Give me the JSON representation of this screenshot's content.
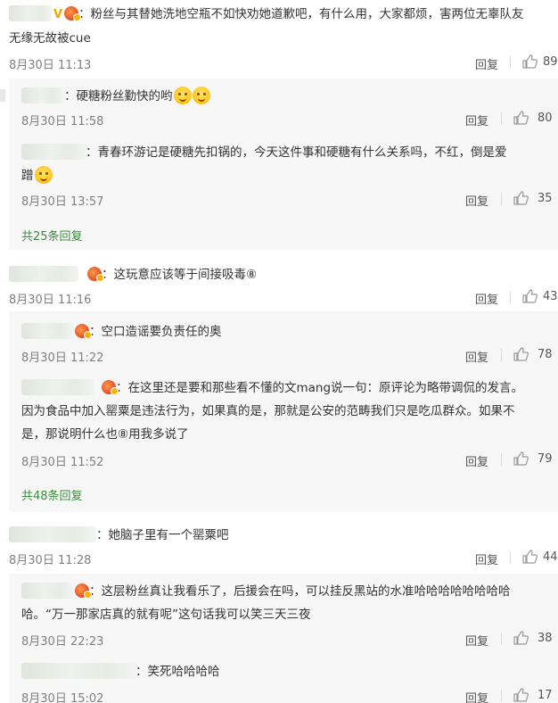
{
  "comments": [
    {
      "text": "：粉丝与其替她洗地空瓶不如快劝她道歉吧，有什么用，大家都烦，害两位无辜队友无缘无故被cue",
      "line1": "：粉丝与其替她洗地空瓶不如快劝她道歉吧，有什么用，大家都烦，害两位无辜队友",
      "line2": "无缘无故被cue",
      "verified_mark": "V",
      "time": "8月30日 11:13",
      "reply": "回复",
      "likes": "89",
      "replies": [
        {
          "text": "：硬糖粉丝勤快的哟",
          "time": "8月30日 11:58",
          "reply": "回复",
          "likes": "80"
        },
        {
          "line1": "：青春环游记是硬糖先扣锅的，今天这件事和硬糖有什么关系吗，不红，倒是爱",
          "line2": "蹭",
          "time": "8月30日 13:57",
          "reply": "回复",
          "likes": "35"
        }
      ],
      "more": "共25条回复"
    },
    {
      "text": "：这玩意应该等于间接吸毒⑧",
      "time": "8月30日 11:16",
      "reply": "回复",
      "likes": "43",
      "replies": [
        {
          "text": "：空口造谣要负责任的奥",
          "time": "8月30日 11:22",
          "reply": "回复",
          "likes": "78"
        },
        {
          "line1": "：在这里还是要和那些看不懂的文mang说一句：原评论为略带调侃的发言。",
          "line2": "因为食品中加入罂粟是违法行为，如果真的是，那就是公安的范畴我们只是吃瓜群众。如果不",
          "line3": "是，那说明什么也⑧用我多说了",
          "time": "8月30日 11:52",
          "reply": "回复",
          "likes": "79"
        }
      ],
      "more": "共48条回复"
    },
    {
      "text": "：她脑子里有一个罂粟吧",
      "time": "8月30日 11:28",
      "reply": "回复",
      "likes": "44",
      "replies": [
        {
          "line1": "：这层粉丝真让我看乐了，后援会在吗，可以挂反黑站的水准哈哈哈哈哈哈哈哈",
          "line2": "哈。“万一那家店真的就有呢”这句话我可以笑三天三夜",
          "time": "8月30日 22:23",
          "reply": "回复",
          "likes": "38"
        },
        {
          "text": "：笑死哈哈哈哈",
          "time": "8月30日 15:02",
          "reply": "回复",
          "likes": "17"
        }
      ]
    }
  ],
  "icons": {
    "like": "thumbs-up-icon",
    "badge": "vip-badge-icon",
    "emoji": "smile-emoji-icon"
  },
  "colors": {
    "text": "#333333",
    "meta": "#808080",
    "link_green": "#3a8b3a",
    "sub_bg": "#f7f7f7"
  }
}
